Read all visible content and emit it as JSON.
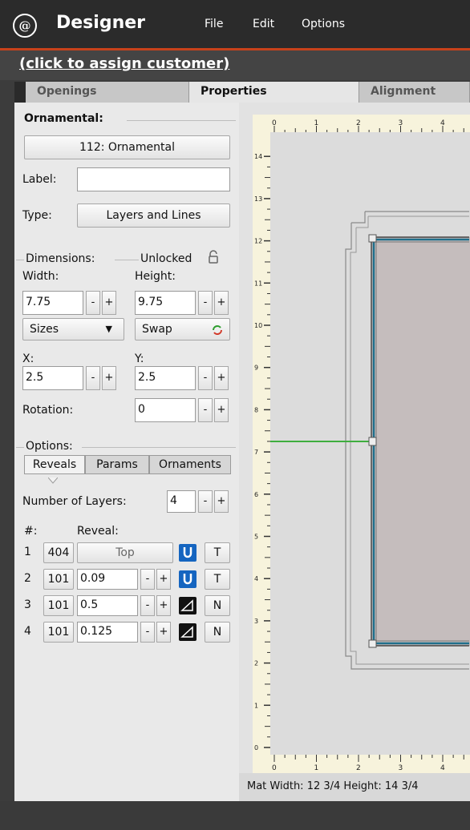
{
  "app": {
    "logo_glyph": "@",
    "title": "Designer",
    "menu": [
      "File",
      "Edit",
      "Options"
    ]
  },
  "customer": {
    "link": "(click to assign customer)"
  },
  "tabs": [
    "Openings",
    "Properties",
    "Alignment"
  ],
  "panel": {
    "section_title": "Ornamental:",
    "item_button": "112: Ornamental",
    "label_label": "Label:",
    "label_value": "",
    "type_label": "Type:",
    "type_value": "Layers and Lines",
    "dimensions_label": "Dimensions:",
    "lock_state": "Unlocked",
    "width_label": "Width:",
    "height_label": "Height:",
    "width_value": "7.75",
    "height_value": "9.75",
    "minus": "-",
    "plus": "+",
    "sizes_select": "Sizes",
    "swap_button": "Swap",
    "x_label": "X:",
    "y_label": "Y:",
    "x_value": "2.5",
    "y_value": "2.5",
    "rotation_label": "Rotation:",
    "rotation_value": "0",
    "options_label": "Options:",
    "subtabs": [
      "Reveals",
      "Params",
      "Ornaments"
    ],
    "num_layers_label": "Number of Layers:",
    "num_layers_value": "4",
    "col_hash": "#:",
    "col_reveal": "Reveal:",
    "layers": [
      {
        "num": "1",
        "code": "404",
        "reveal": "Top",
        "icon": "cup-icon",
        "flag": "T"
      },
      {
        "num": "2",
        "code": "101",
        "reveal": "0.09",
        "icon": "cup-icon",
        "flag": "T"
      },
      {
        "num": "3",
        "code": "101",
        "reveal": "0.5",
        "icon": "bevel-45-icon",
        "flag": "N"
      },
      {
        "num": "4",
        "code": "101",
        "reveal": "0.125",
        "icon": "bevel-45-icon",
        "flag": "N"
      }
    ]
  },
  "ruler": {
    "top": [
      "0",
      "1",
      "2",
      "3",
      "4"
    ],
    "left": [
      "14",
      "13",
      "12",
      "11",
      "10",
      "9",
      "8",
      "7",
      "6",
      "5",
      "4",
      "3",
      "2",
      "1",
      "0"
    ]
  },
  "status": {
    "text": "Mat  Width: 12 3/4  Height: 14 3/4"
  },
  "colors": {
    "accent": "#c8421b",
    "frame": "#1f6f8b",
    "guide": "#3fae3f"
  }
}
